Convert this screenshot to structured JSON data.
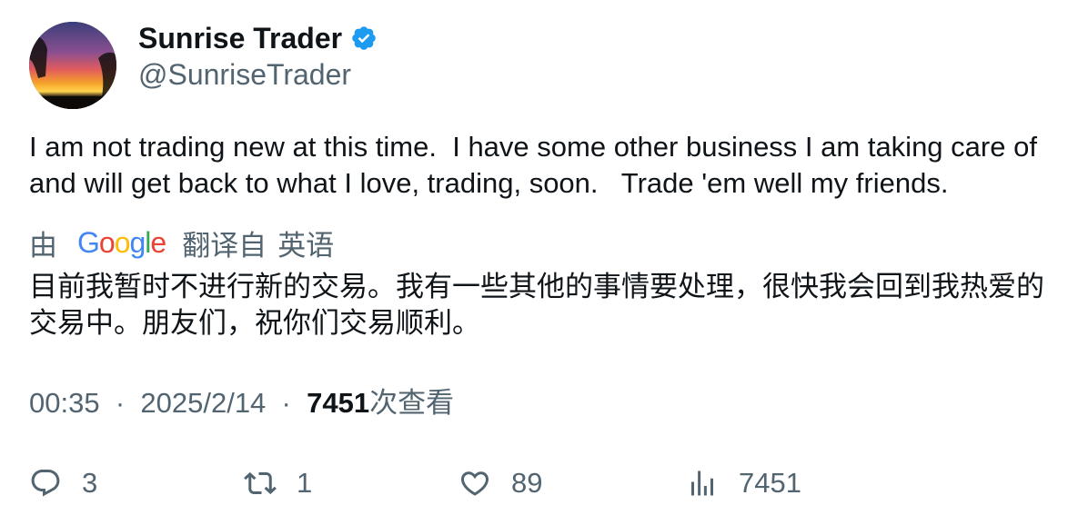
{
  "author": {
    "display_name": "Sunrise Trader",
    "handle": "@SunriseTrader",
    "verified": true
  },
  "tweet": {
    "text": "I am not trading new at this time.  I have some other business I am taking care of and will get back to what I love, trading, soon.   Trade 'em well my friends."
  },
  "translation": {
    "prefix": "由",
    "provider": "Google",
    "suffix": "翻译自",
    "language": "英语",
    "text": "目前我暂时不进行新的交易。我有一些其他的事情要处理，很快我会回到我热爱的交易中。朋友们，祝你们交易顺利。"
  },
  "meta": {
    "time": "00:35",
    "date": "2025/2/14",
    "separator": "·",
    "views": "7451",
    "views_label": "次查看"
  },
  "actions": {
    "replies": "3",
    "retweets": "1",
    "likes": "89",
    "views": "7451"
  },
  "colors": {
    "text": "#0f1419",
    "secondary": "#536471",
    "verified": "#1d9bf0"
  }
}
